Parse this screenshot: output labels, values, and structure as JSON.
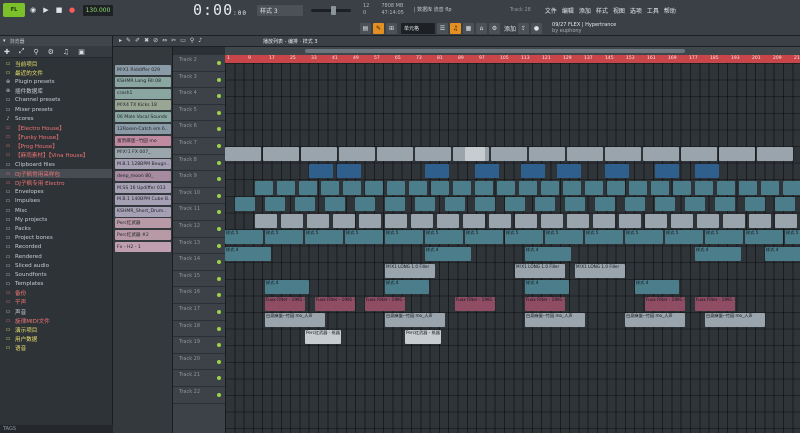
{
  "toolbar": {
    "logo": "FL",
    "tempo": "130.000",
    "time_main": "0:00",
    "time_sub": ":00",
    "pattern": "样式 3",
    "cpu_top": "12",
    "cpu_mem": "7808 MB",
    "cpu_voices": "47:14:05",
    "cpu_bottom": "0",
    "hint_top": "| 数据库 流音 flp",
    "hint_bottom": "",
    "track_label": "Track 28",
    "menu": [
      "文件",
      "编辑",
      "添加",
      "样式",
      "视图",
      "选项",
      "工具",
      "帮助"
    ],
    "snap": "单元格",
    "add_label": "添加",
    "news_top": "09/27 FLEX | Hypertrance",
    "news_bottom": "by euphony",
    "colors": {
      "accent": "#e38f22",
      "logo": "#7bbf2a",
      "ruler": "#c8464a"
    }
  },
  "playlist": {
    "breadcrumb": "播放列表 - 编排 · 样式 3",
    "ruler": [
      "1",
      "9",
      "17",
      "25",
      "33",
      "41",
      "49",
      "57",
      "65",
      "73",
      "81",
      "89",
      "97",
      "105",
      "113",
      "121",
      "129",
      "137",
      "145",
      "153",
      "161",
      "169",
      "177",
      "185",
      "193",
      "201",
      "209",
      "217"
    ],
    "tracks": [
      "Track 2",
      "Track 3",
      "Track 4",
      "Track 5",
      "Track 6",
      "Track 7",
      "Track 8",
      "Track 9",
      "Track 10",
      "Track 11",
      "Track 12",
      "Track 13",
      "Track 14",
      "Track 15",
      "Track 16",
      "Track 17",
      "Track 18",
      "Track 19",
      "Track 20",
      "Track 21",
      "Track 22"
    ]
  },
  "browser": {
    "header": "浏览器",
    "footer": "TAGS",
    "items": [
      {
        "icon": "📁",
        "label": "当前项目",
        "color": "#e8e06a"
      },
      {
        "icon": "📁",
        "label": "最近的文件",
        "color": "#e8e06a"
      },
      {
        "icon": "🔌",
        "label": "Plugin presets",
        "color": "#c6cdd2"
      },
      {
        "icon": "🔌",
        "label": "插件数据库",
        "color": "#c6cdd2"
      },
      {
        "icon": "📁",
        "label": "Channel presets",
        "color": "#c6cdd2"
      },
      {
        "icon": "📁",
        "label": "Mixer presets",
        "color": "#c6cdd2"
      },
      {
        "icon": "♪",
        "label": "Scores",
        "color": "#c6cdd2"
      },
      {
        "icon": "📁",
        "label": "【Electro House】",
        "color": "#f07474"
      },
      {
        "icon": "📁",
        "label": "【Funky House】",
        "color": "#f07474"
      },
      {
        "icon": "📁",
        "label": "【Prog House】",
        "color": "#f07474"
      },
      {
        "icon": "📁",
        "label": "【麻雨素材】【Vina House】",
        "color": "#f07474"
      },
      {
        "icon": "📁",
        "label": "Clipboard files",
        "color": "#c6cdd2"
      },
      {
        "icon": "📁",
        "label": "DJ子枫常用采样包",
        "color": "#f07474"
      },
      {
        "icon": "📁",
        "label": "DJ子枫专用 Electro",
        "color": "#f07474"
      },
      {
        "icon": "📁",
        "label": "Envelopes",
        "color": "#c6cdd2"
      },
      {
        "icon": "📁",
        "label": "Impulses",
        "color": "#c6cdd2"
      },
      {
        "icon": "📁",
        "label": "Misc",
        "color": "#c6cdd2"
      },
      {
        "icon": "📁",
        "label": "My projects",
        "color": "#c6cdd2"
      },
      {
        "icon": "📁",
        "label": "Packs",
        "color": "#c6cdd2"
      },
      {
        "icon": "📁",
        "label": "Project bones",
        "color": "#c6cdd2"
      },
      {
        "icon": "📁",
        "label": "Recorded",
        "color": "#c6cdd2"
      },
      {
        "icon": "📁",
        "label": "Rendered",
        "color": "#c6cdd2"
      },
      {
        "icon": "📁",
        "label": "Sliced audio",
        "color": "#c6cdd2"
      },
      {
        "icon": "📁",
        "label": "Soundfonts",
        "color": "#c6cdd2"
      },
      {
        "icon": "📁",
        "label": "Templates",
        "color": "#c6cdd2"
      },
      {
        "icon": "📁",
        "label": "备份",
        "color": "#f07474"
      },
      {
        "icon": "📁",
        "label": "干声",
        "color": "#f07474"
      },
      {
        "icon": "📁",
        "label": "声音",
        "color": "#c6cdd2"
      },
      {
        "icon": "📁",
        "label": "旋律MIDI文件",
        "color": "#f07474"
      },
      {
        "icon": "📁",
        "label": "演示项目",
        "color": "#e8e06a"
      },
      {
        "icon": "📁",
        "label": "用户数据",
        "color": "#e8e06a"
      },
      {
        "icon": "📁",
        "label": "语音",
        "color": "#e8e06a"
      }
    ]
  },
  "picker": [
    {
      "label": "M!X1 Riddiffer 029",
      "color": "#8a9aa6"
    },
    {
      "label": "KSHMR Long Fill 08",
      "color": "#8aa6a0"
    },
    {
      "label": "crash1",
      "color": "#8aa6a0"
    },
    {
      "label": "M!X4 TX Kicks 18",
      "color": "#9aa694"
    },
    {
      "label": "06 Male Vocal Sounds",
      "color": "#8aa6a0"
    },
    {
      "label": "12Rosen-Catch em 6..",
      "color": "#8a9aa6"
    },
    {
      "label": "富贵麻蛋--竹园 mo",
      "color": "#c08aa0"
    },
    {
      "label": "M!X!1 FX 007_",
      "color": "#9aa6ac"
    },
    {
      "label": "M.B.1 128BPM Beugn..",
      "color": "#a6a0b4"
    },
    {
      "label": "deep_moon 80_",
      "color": "#a68aa0"
    },
    {
      "label": "M.SS 16 Updiffer 013",
      "color": "#a6a0b4"
    },
    {
      "label": "M.B.1 140BPM Cube B..",
      "color": "#a6a0b4"
    },
    {
      "label": "KSHMR_Short_Drum..",
      "color": "#a6a0b4"
    },
    {
      "label": "Perc红武器",
      "color": "#b89aa6"
    },
    {
      "label": "Perc红武器 #2",
      "color": "#b89aa6"
    },
    {
      "label": "Fx - H2 - 1",
      "color": "#c0a0b0"
    }
  ],
  "clips": {
    "pattern_label": "样式 4",
    "pattern_label_b": "样式 5",
    "fx_label": "Fuxx Filter - 1991 - 音频",
    "vocal_label": "白泉麻蛋--竹园 mo_人声",
    "fill_label": "M!X1 LONG 1.0 Filler",
    "perc_label": "Perc红武器 - 纸器"
  }
}
